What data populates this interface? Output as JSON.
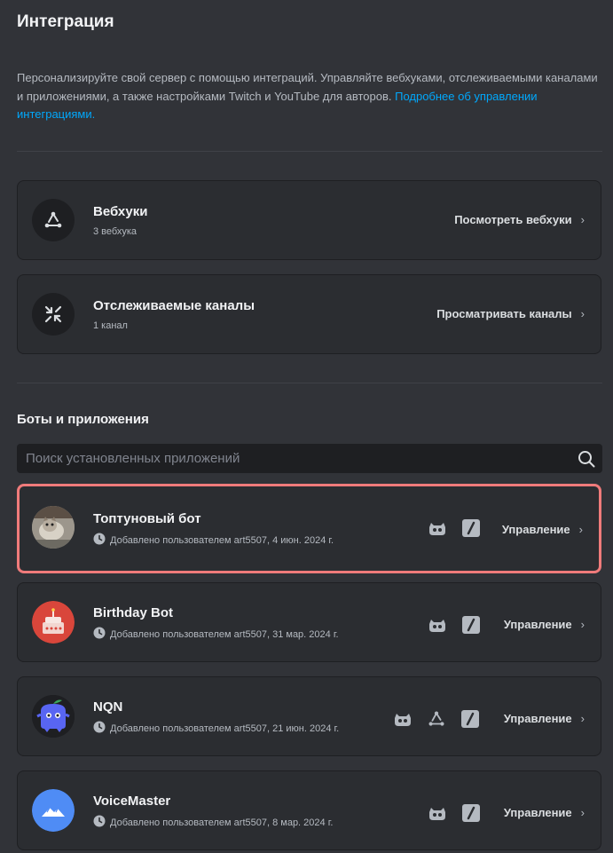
{
  "page": {
    "title": "Интеграция",
    "description": "Персонализируйте свой сервер с помощью интеграций. Управляйте вебхуками, отслеживаемыми каналами и приложениями, а также настройками Twitch и YouTube для авторов. ",
    "learn_more_link": "Подробнее об управлении интеграциями."
  },
  "webhooks": {
    "title": "Вебхуки",
    "subtitle": "3 вебхука",
    "action": "Посмотреть вебхуки",
    "icon": "webhook-icon"
  },
  "followed_channels": {
    "title": "Отслеживаемые каналы",
    "subtitle": "1 канал",
    "action": "Просматривать каналы",
    "icon": "channel-follow-icon"
  },
  "bots": {
    "section_title": "Боты и приложения",
    "search_placeholder": "Поиск установленных приложений",
    "manage_label": "Управление",
    "items": [
      {
        "name": "Топтуновый бот",
        "added": "Добавлено пользователем art5507, 4 июн. 2024 г.",
        "avatar": "cat-photo",
        "permissions": [
          "bot-icon",
          "slash-command-icon"
        ]
      },
      {
        "name": "Birthday Bot",
        "added": "Добавлено пользователем art5507, 31 мар. 2024 г.",
        "avatar": "cake",
        "permissions": [
          "bot-icon",
          "slash-command-icon"
        ]
      },
      {
        "name": "NQN",
        "added": "Добавлено пользователем art5507, 21 июн. 2024 г.",
        "avatar": "blurple-creature",
        "permissions": [
          "bot-icon",
          "webhook-icon",
          "slash-command-icon"
        ]
      },
      {
        "name": "VoiceMaster",
        "added": "Добавлено пользователем art5507, 8 мар. 2024 г.",
        "avatar": "mountains",
        "permissions": [
          "bot-icon",
          "slash-command-icon"
        ]
      }
    ]
  },
  "colors": {
    "background": "#313338",
    "card": "#2b2d31",
    "link": "#00a8fc",
    "selected_outline": "#f07b7b",
    "blurple": "#5865f2",
    "voicemaster_blue": "#4f8cf5",
    "birthday_red": "#d9463b"
  }
}
